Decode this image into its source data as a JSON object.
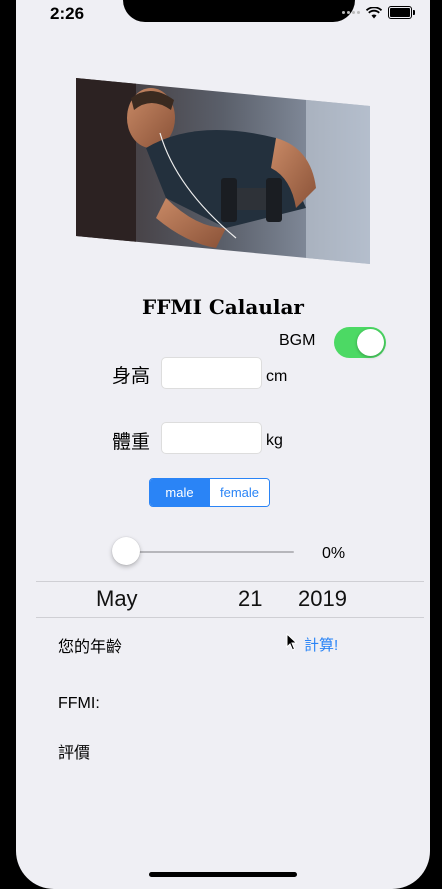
{
  "status_bar": {
    "time": "2:26"
  },
  "app": {
    "title": "FFMI Calaular"
  },
  "bgm": {
    "label": "BGM",
    "on": true
  },
  "height": {
    "label": "身高",
    "value": "",
    "unit": "cm"
  },
  "weight": {
    "label": "體重",
    "value": "",
    "unit": "kg"
  },
  "gender": {
    "options": [
      "male",
      "female"
    ],
    "selected": "male"
  },
  "body_fat_slider": {
    "value_text": "0%",
    "fraction": 0.0
  },
  "date_picker": {
    "month": "May",
    "day": "21",
    "year": "2019"
  },
  "age": {
    "label": "您的年齡"
  },
  "calculate_button": {
    "label": "計算!"
  },
  "result": {
    "ffmi_label": "FFMI:",
    "rating_label": "評價"
  },
  "colors": {
    "accent": "#2a84f6",
    "toggle_on": "#4cd964",
    "background": "#efeff4"
  }
}
